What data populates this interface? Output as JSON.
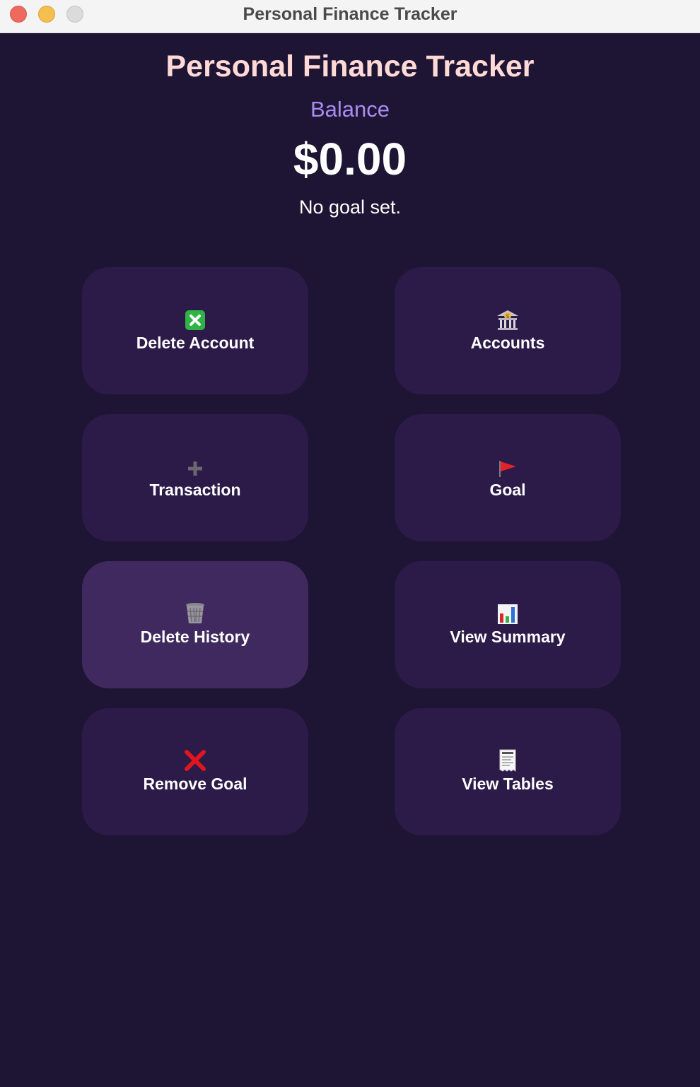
{
  "window": {
    "title": "Personal Finance Tracker"
  },
  "header": {
    "title": "Personal Finance Tracker",
    "balance_label": "Balance",
    "balance_value": "$0.00",
    "goal_status": "No goal set."
  },
  "buttons": [
    {
      "label": "Delete Account",
      "icon": "cross-mark-button-icon"
    },
    {
      "label": "Accounts",
      "icon": "bank-icon"
    },
    {
      "label": "Transaction",
      "icon": "plus-icon"
    },
    {
      "label": "Goal",
      "icon": "flag-icon"
    },
    {
      "label": "Delete History",
      "icon": "wastebasket-icon"
    },
    {
      "label": "View Summary",
      "icon": "bar-chart-icon"
    },
    {
      "label": "Remove Goal",
      "icon": "red-cross-icon"
    },
    {
      "label": "View Tables",
      "icon": "receipt-icon"
    }
  ],
  "colors": {
    "background": "#1e1433",
    "button": "#2c1a49",
    "button_active": "#40295f",
    "title": "#ffd9d6",
    "balance_label": "#a98cf2"
  }
}
